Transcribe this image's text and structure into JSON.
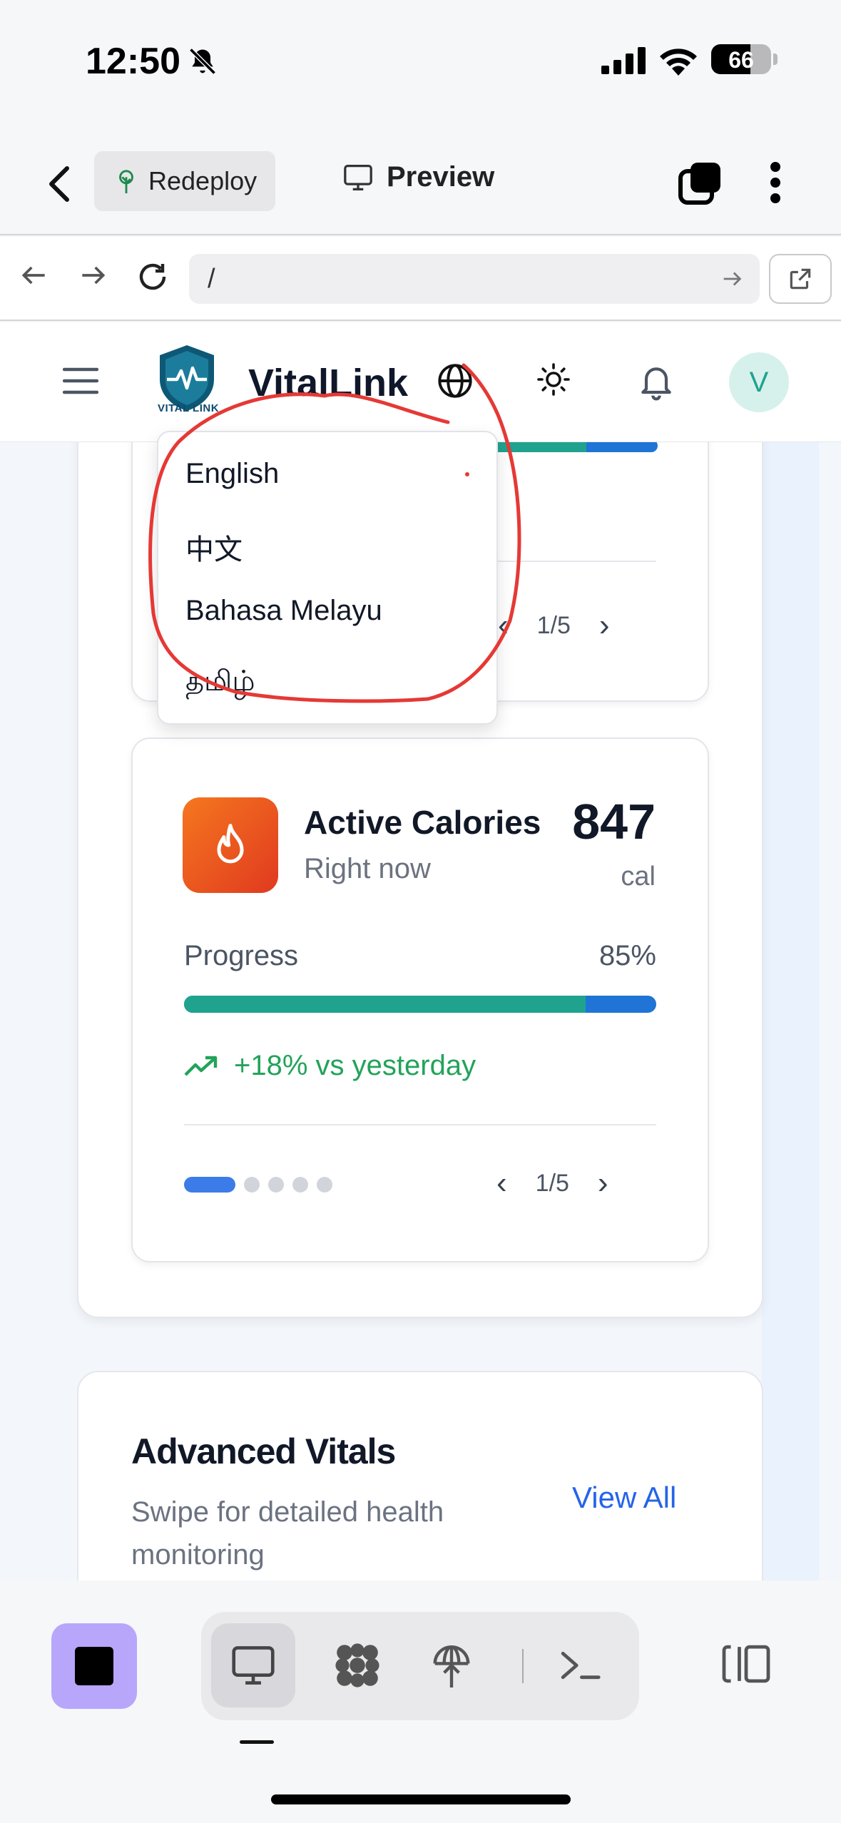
{
  "status_bar": {
    "time": "12:50",
    "battery": "66"
  },
  "app_bar": {
    "redeploy_label": "Redeploy",
    "preview_label": "Preview"
  },
  "url_bar": {
    "url": "/"
  },
  "site_header": {
    "brand": "VitalLink",
    "logo_text": "VITAL LINK",
    "avatar_initial": "V"
  },
  "language_menu": {
    "items": [
      "English",
      "中文",
      "Bahasa Melayu",
      "தமிழ்"
    ],
    "selected": "English"
  },
  "top_card": {
    "progress": 0.85,
    "page": "1/5"
  },
  "calories_card": {
    "title": "Active Calories",
    "subtitle": "Right now",
    "value": "847",
    "unit": "cal",
    "progress_label": "Progress",
    "progress_pct": "85%",
    "progress": 0.85,
    "trend": "+18% vs yesterday",
    "page": "1/5"
  },
  "advanced_vitals": {
    "title": "Advanced Vitals",
    "subtitle": "Swipe for detailed health monitoring",
    "view_all": "View All"
  },
  "colors": {
    "accent_teal": "#1fa38f",
    "accent_blue": "#1f74d6",
    "trend_green": "#22a35a",
    "link_blue": "#2563eb",
    "annotation_red": "#e53935",
    "stop_button": "#b8a6fb"
  },
  "icons": {
    "bell_off": "bell-slash-icon",
    "theme": "sun-icon",
    "language": "globe-icon",
    "notifications": "bell-icon",
    "calories": "flame-icon",
    "trend": "trending-up-icon"
  }
}
